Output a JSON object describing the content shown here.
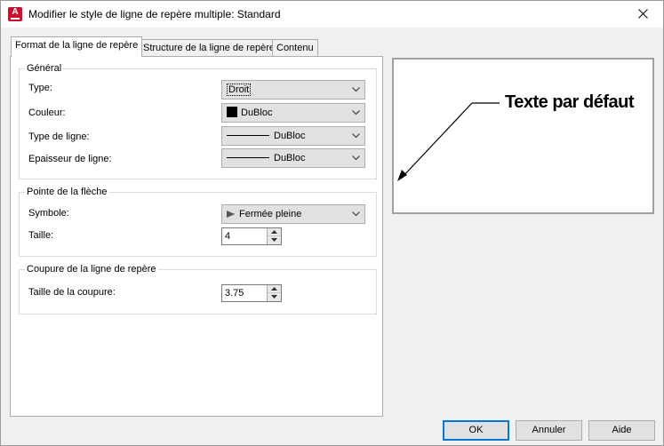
{
  "window": {
    "title": "Modifier le style de ligne de repère multiple: Standard",
    "app_icon": "autocad-icon",
    "app_icon_letter": "A"
  },
  "tabs": [
    {
      "label": "Format de la ligne de repère",
      "active": true
    },
    {
      "label": "Structure de la ligne de repère",
      "active": false
    },
    {
      "label": "Contenu",
      "active": false
    }
  ],
  "general": {
    "group_label": "Général",
    "type": {
      "label": "Type:",
      "value": "Droit"
    },
    "color": {
      "label": "Couleur:",
      "value": "DuBloc",
      "swatch_color": "#000000"
    },
    "linetype": {
      "label": "Type de ligne:",
      "value": "DuBloc"
    },
    "lineweight": {
      "label": "Epaisseur de ligne:",
      "value": "DuBloc"
    }
  },
  "arrowhead": {
    "group_label": "Pointe de la flèche",
    "symbol": {
      "label": "Symbole:",
      "value": "Fermée pleine"
    },
    "size": {
      "label": "Taille:",
      "value": "4"
    }
  },
  "landing_break": {
    "group_label": "Coupure de la ligne de repère",
    "break_size": {
      "label": "Taille de la coupure:",
      "value": "3.75"
    }
  },
  "preview": {
    "text": "Texte par défaut"
  },
  "buttons": {
    "ok": "OK",
    "cancel": "Annuler",
    "help": "Aide"
  },
  "colors": {
    "accent": "#0078d7",
    "app_icon": "#c8102e"
  }
}
